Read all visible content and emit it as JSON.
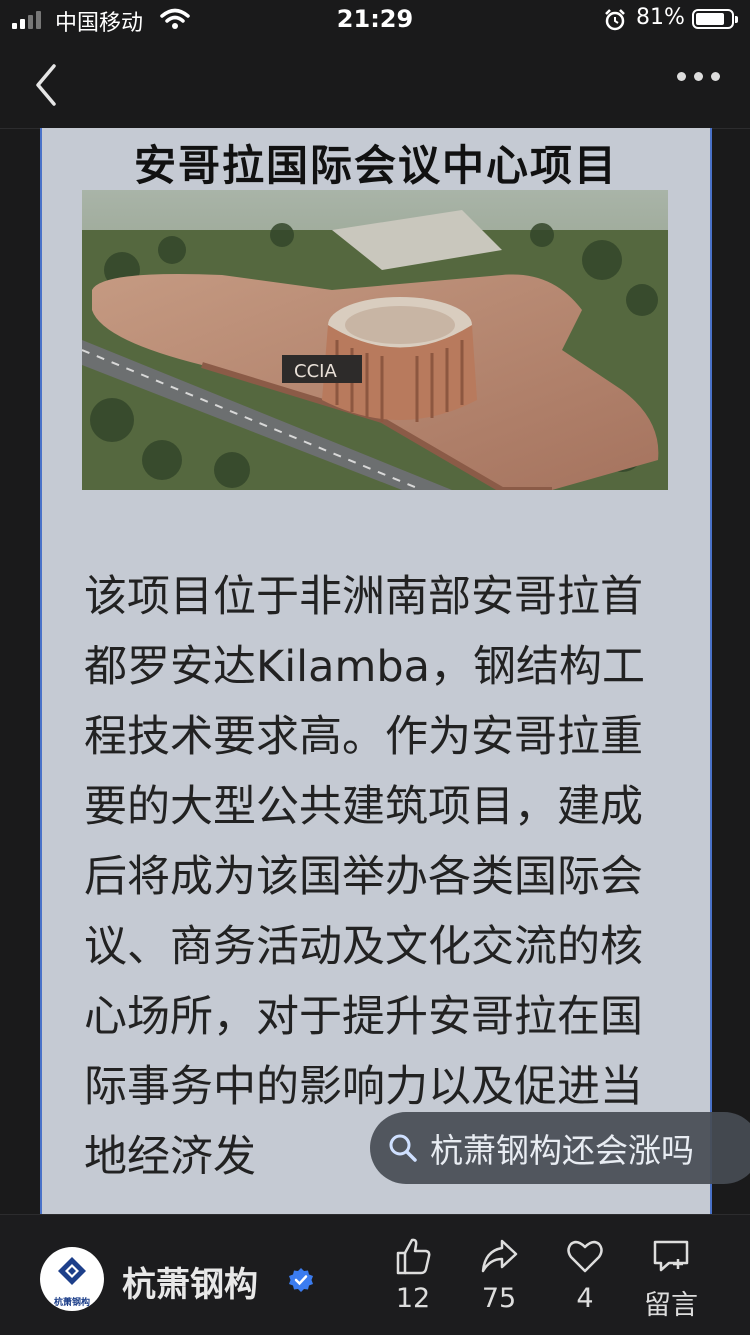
{
  "status_bar": {
    "carrier": "中国移动",
    "time": "21:29",
    "battery": "81%",
    "battery_level": 0.81
  },
  "article": {
    "title": "安哥拉国际会议中心项目",
    "image_sign_text": "CCIA",
    "body": "该项目位于非洲南部安哥拉首都罗安达Kilamba，钢结构工程技术要求高。作为安哥拉重要的大型公共建筑项目，建成后将成为该国举办各类国际会议、商务活动及文化交流的核心场所，对于提升安哥拉在国际事务中的影响力以及促进当地经济发"
  },
  "search_chip": {
    "text": "杭萧钢构还会涨吗",
    "icon": "search-icon"
  },
  "bottom_bar": {
    "account_name": "杭萧钢构",
    "avatar_text": "杭萧钢构",
    "like_count": "12",
    "share_count": "75",
    "favorite_count": "4",
    "comment_label": "留言"
  },
  "colors": {
    "background": "#1a1a1b",
    "article_bg": "#c5cad3",
    "article_border": "#4a72c8",
    "verified": "#3b7cf0"
  }
}
